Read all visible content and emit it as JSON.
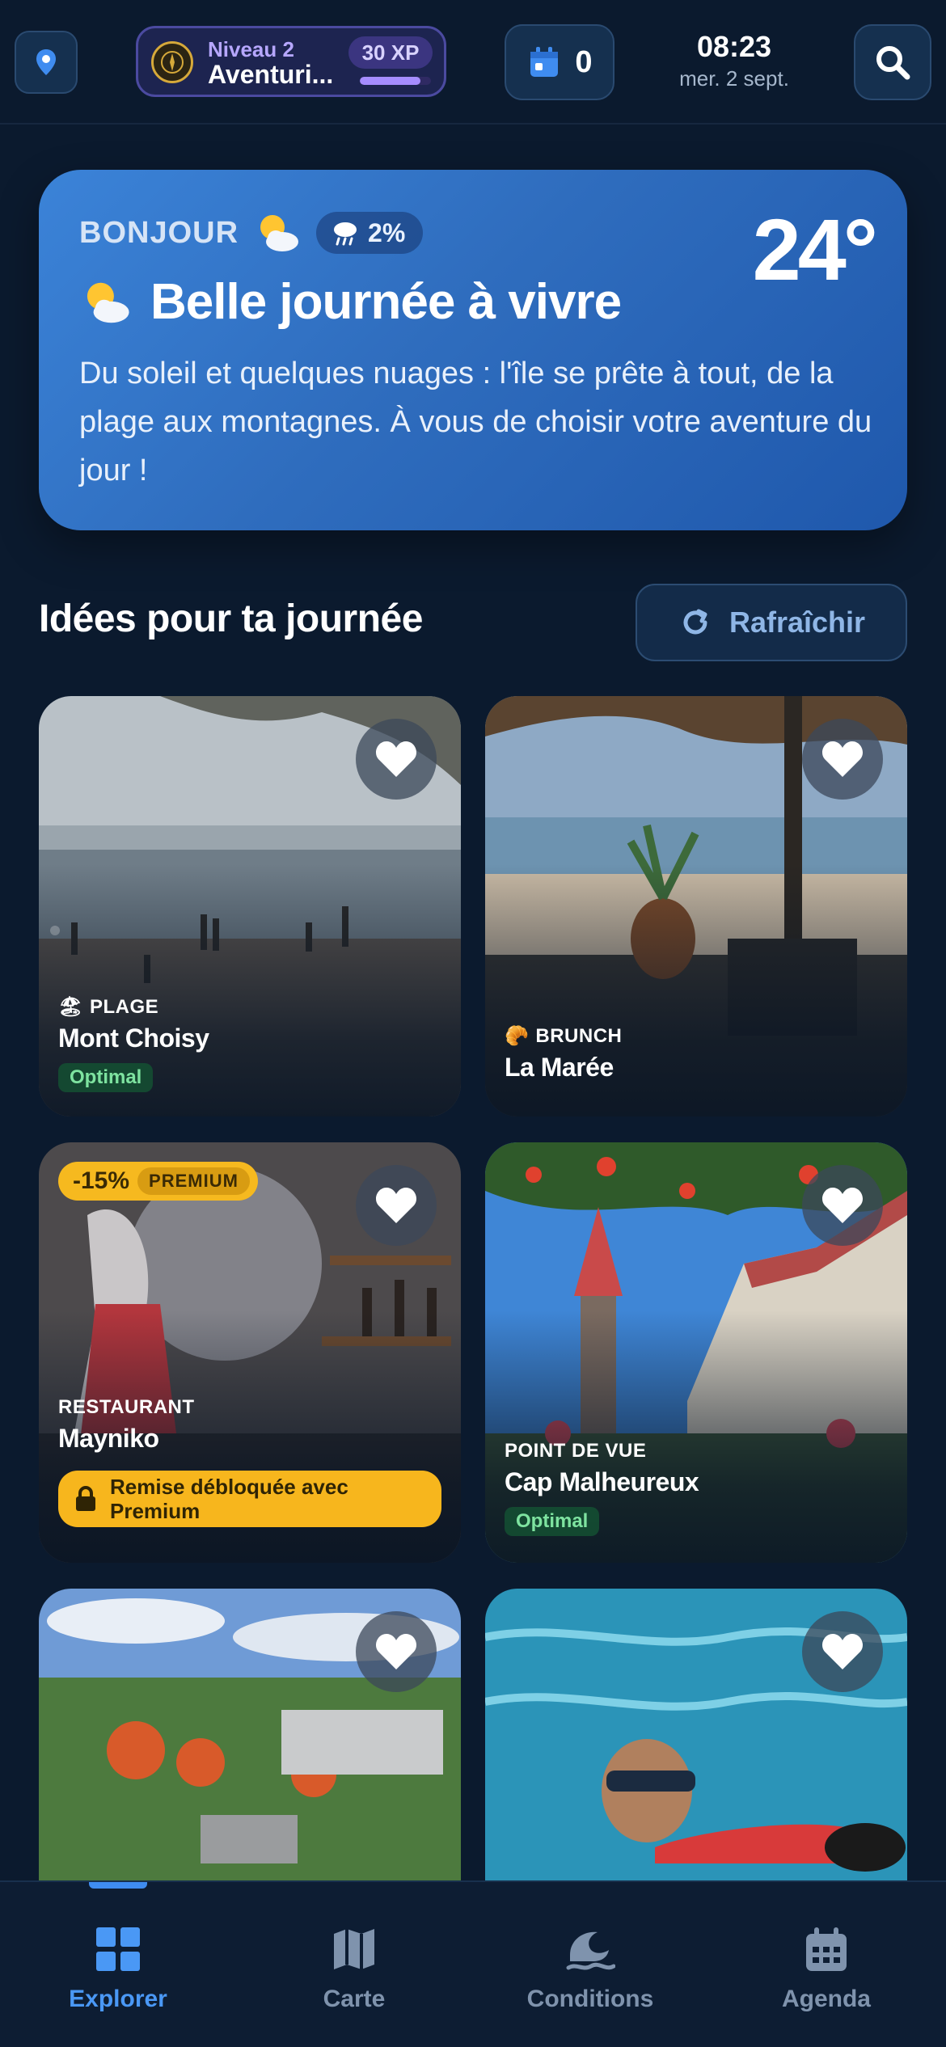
{
  "header": {
    "level_label": "Niveau 2",
    "level_name": "Aventuri...",
    "xp_label": "30 XP",
    "xp_progress_percent": 85,
    "agenda_count": "0",
    "time": "08:23",
    "date": "mer. 2 sept."
  },
  "weather": {
    "greeting": "BONJOUR",
    "rain_chance": "2%",
    "temperature": "24°",
    "title": "Belle journée à vivre",
    "description": "Du soleil et quelques nuages : l'île se prête à tout, de la plage aux montagnes. À vous de choisir votre aventure du jour !"
  },
  "ideas": {
    "title": "Idées pour ta journée",
    "refresh_label": "Rafraîchir"
  },
  "cards": [
    {
      "category": "PLAGE",
      "category_emoji": "🏖",
      "name": "Mont Choisy",
      "status": "Optimal"
    },
    {
      "category": "BRUNCH",
      "category_emoji": "🥐",
      "name": "La Marée"
    },
    {
      "category": "RESTAURANT",
      "name": "Mayniko",
      "promo_percent": "-15%",
      "promo_tag": "PREMIUM",
      "unlock_text": "Remise débloquée avec Premium"
    },
    {
      "category": "POINT DE VUE",
      "name": "Cap Malheureux",
      "status": "Optimal"
    },
    {
      "category": "",
      "name": ""
    },
    {
      "category": "",
      "name": ""
    }
  ],
  "nav": {
    "items": [
      {
        "label": "Explorer",
        "icon": "grid-icon"
      },
      {
        "label": "Carte",
        "icon": "map-icon"
      },
      {
        "label": "Conditions",
        "icon": "wave-icon"
      },
      {
        "label": "Agenda",
        "icon": "calendar-icon"
      }
    ],
    "active_color": "#4a98f5",
    "inactive_color": "#7f93ad"
  },
  "colors": {
    "background": "#0b1a2e",
    "weather_card": "#2f6dbe",
    "premium_yellow": "#f6b91f",
    "optimal_green": "#7ee3a0"
  }
}
